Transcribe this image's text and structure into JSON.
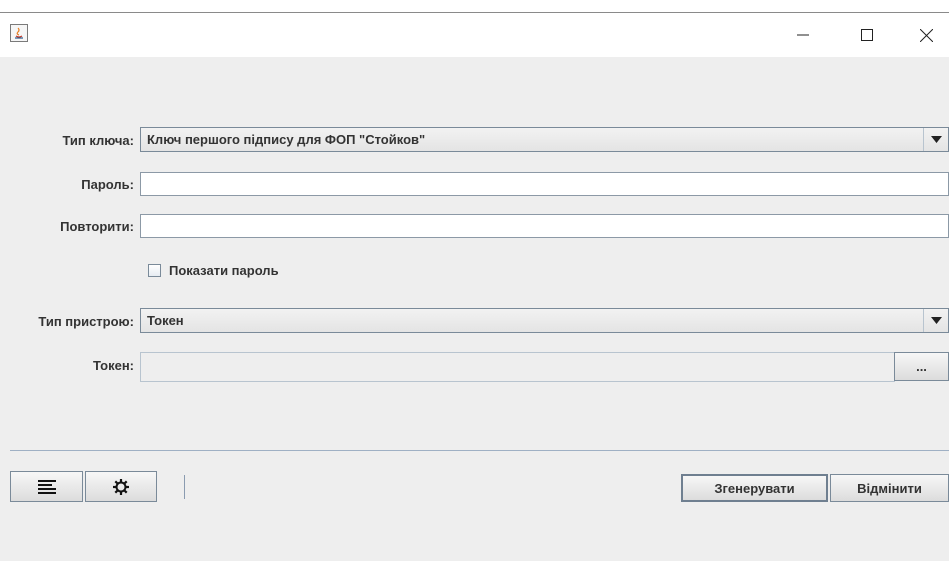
{
  "window": {
    "title": "",
    "controls": {
      "minimize": "minimize-icon",
      "maximize": "maximize-icon",
      "close": "close-icon"
    }
  },
  "form": {
    "key_type": {
      "label": "Тип ключа:",
      "value": "Ключ першого підпису для ФОП \"Стойков\""
    },
    "password": {
      "label": "Пароль:",
      "value": ""
    },
    "repeat": {
      "label": "Повторити:",
      "value": ""
    },
    "show_password": {
      "label": "Показати пароль",
      "checked": false
    },
    "device_type": {
      "label": "Тип пристрою:",
      "value": "Токен"
    },
    "token": {
      "label": "Токен:",
      "value": "",
      "browse_label": "..."
    }
  },
  "footer": {
    "icons": [
      "list-icon",
      "gear-icon"
    ],
    "generate_label": "Згенерувати",
    "cancel_label": "Відмінити"
  },
  "colors": {
    "window_bg": "#eeeeee",
    "border": "#7a8a99",
    "text": "#333333"
  }
}
